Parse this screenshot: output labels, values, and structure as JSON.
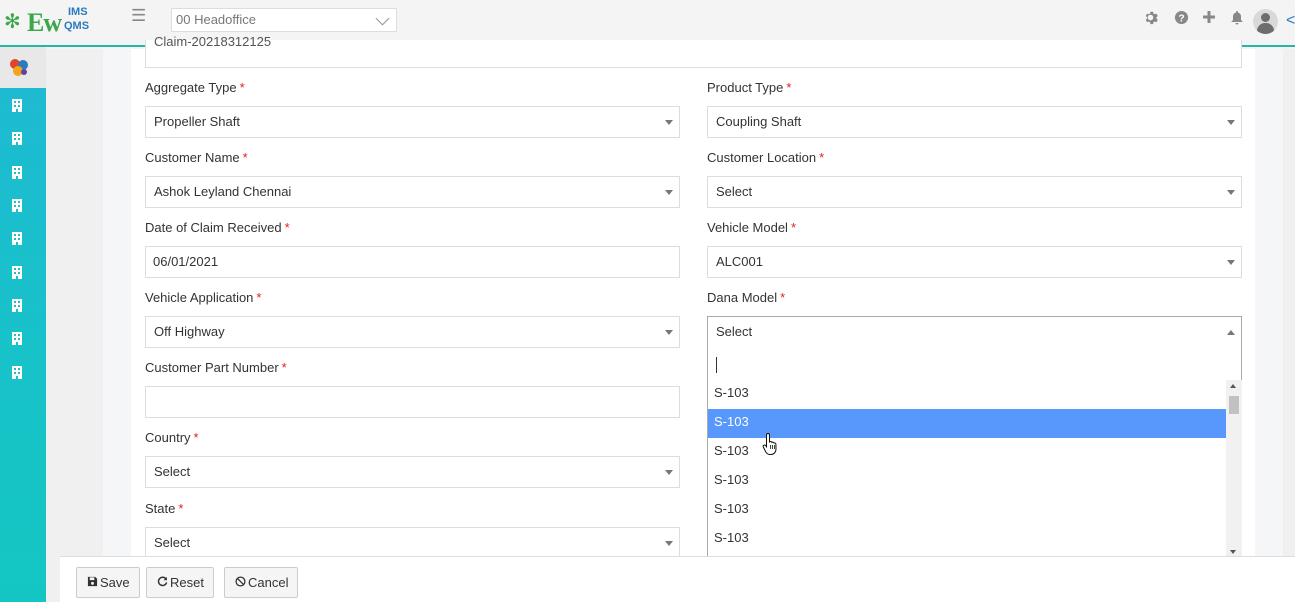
{
  "header": {
    "logo_ew": "Ew",
    "logo_ims": "IMS",
    "logo_qms": "QMS",
    "office_select": "00 Headoffice",
    "icons": [
      "gear-icon",
      "help-icon",
      "plus-icon",
      "bell-icon",
      "user-avatar-icon"
    ]
  },
  "sidebar": {
    "items": [
      "building-icon",
      "building-icon",
      "building-icon",
      "building-icon",
      "building-icon",
      "building-icon",
      "building-icon",
      "building-icon",
      "building-icon"
    ]
  },
  "form": {
    "claim_number": "Claim-20218312125",
    "aggregate_type": {
      "label": "Aggregate Type",
      "value": "Propeller Shaft"
    },
    "product_type": {
      "label": "Product Type",
      "value": "Coupling Shaft"
    },
    "customer_name": {
      "label": "Customer Name",
      "value": "Ashok Leyland Chennai"
    },
    "customer_location": {
      "label": "Customer Location",
      "value": "Select"
    },
    "date_of_claim": {
      "label": "Date of Claim Received",
      "value": "06/01/2021"
    },
    "vehicle_model": {
      "label": "Vehicle Model",
      "value": "ALC001"
    },
    "vehicle_application": {
      "label": "Vehicle Application",
      "value": "Off Highway"
    },
    "dana_model": {
      "label": "Dana Model",
      "value": "Select"
    },
    "customer_part_number": {
      "label": "Customer Part Number",
      "value": ""
    },
    "country": {
      "label": "Country",
      "value": "Select"
    },
    "state": {
      "label": "State",
      "value": "Select"
    },
    "required_mark": "*"
  },
  "dropdown": {
    "search_value": "",
    "options": [
      "S-103",
      "S-103",
      "S-103",
      "S-103",
      "S-103",
      "S-103"
    ],
    "highlighted_index": 1
  },
  "footer": {
    "save_label": "Save",
    "reset_label": "Reset",
    "cancel_label": "Cancel"
  }
}
